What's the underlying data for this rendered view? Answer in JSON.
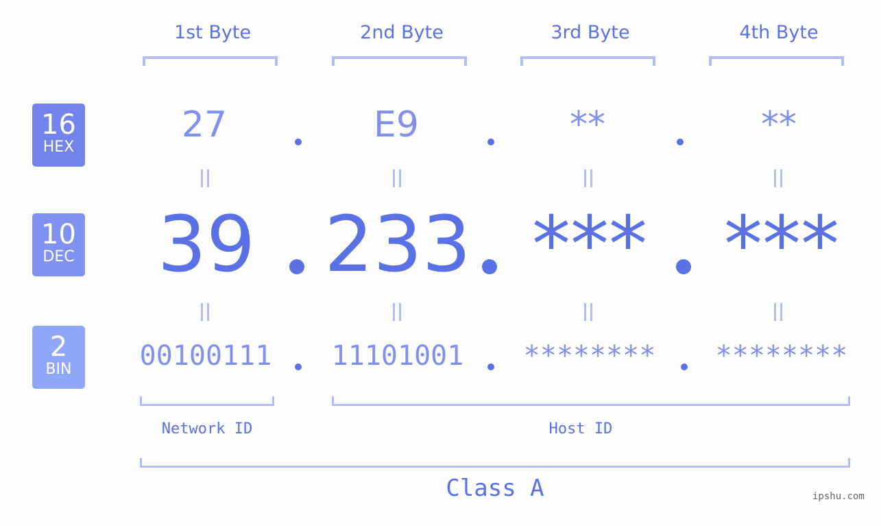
{
  "byte_headers": [
    "1st Byte",
    "2nd Byte",
    "3rd Byte",
    "4th Byte"
  ],
  "badges": {
    "hex": {
      "num": "16",
      "label": "HEX",
      "color": "#7383ec"
    },
    "dec": {
      "num": "10",
      "label": "DEC",
      "color": "#8191f0"
    },
    "bin": {
      "num": "2",
      "label": "BIN",
      "color": "#90a7f8"
    }
  },
  "hex_values": [
    "27",
    "E9",
    "**",
    "**"
  ],
  "dec_values": [
    "39",
    "233",
    "***",
    "***"
  ],
  "bin_values": [
    "00100111",
    "11101001",
    "********",
    "********"
  ],
  "network_label": "Network ID",
  "host_label": "Host ID",
  "class_label": "Class A",
  "watermark": "ipshu.com",
  "colors": {
    "accent": "#5a70e5",
    "light": "#8090ec",
    "bracket": "#b3bcf5"
  }
}
